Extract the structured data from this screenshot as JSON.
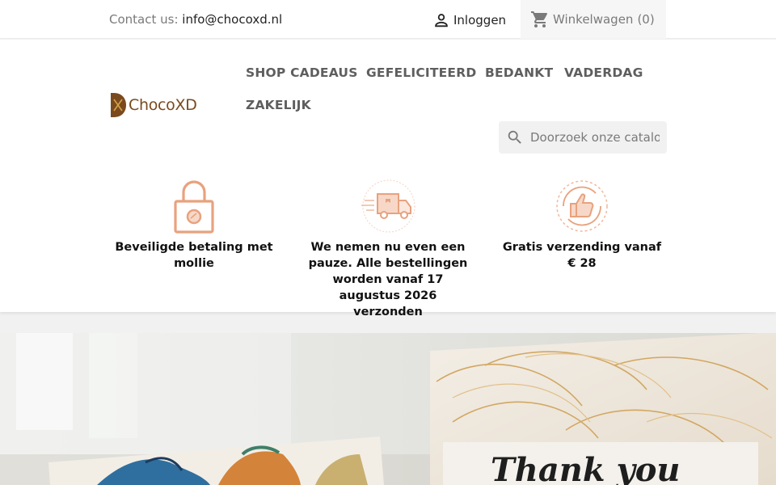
{
  "topbar": {
    "contact_label": "Contact us:",
    "contact_email": "info@chocoxd.nl",
    "login_label": "Inloggen",
    "cart_label": "Winkelwagen",
    "cart_count": "(0)"
  },
  "logo": {
    "text": "ChocoXD"
  },
  "nav": {
    "items": [
      {
        "label": "SHOP CADEAUS"
      },
      {
        "label": "GEFELICITEERD"
      },
      {
        "label": "BEDANKT"
      },
      {
        "label": "VADERDAG"
      },
      {
        "label": "ZAKELIJK"
      }
    ]
  },
  "search": {
    "placeholder": "Doorzoek onze catalogus"
  },
  "features": [
    {
      "icon": "lock-icon",
      "text": "Beveiligde betaling met mollie"
    },
    {
      "icon": "delivery-truck-icon",
      "text": "We nemen nu even een pauze. Alle bestellingen worden vanaf 17 augustus 2026 verzonden"
    },
    {
      "icon": "thumbs-up-icon",
      "text": "Gratis verzending vanaf € 28"
    }
  ],
  "hero": {
    "card_text": "Thank you"
  },
  "colors": {
    "accent": "#e8a27e",
    "brand": "#7a4a1e",
    "nav_text": "#5e5e5e"
  }
}
